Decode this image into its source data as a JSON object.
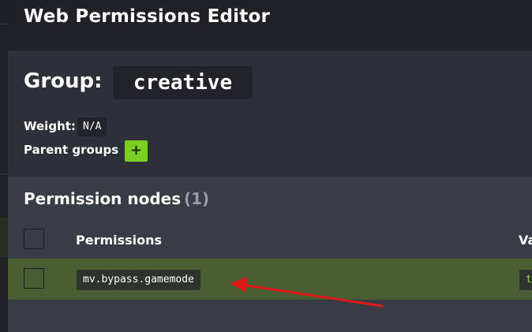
{
  "app": {
    "title": "Web Permissions Editor"
  },
  "group": {
    "label": "Group:",
    "name": "creative",
    "weight_label": "Weight:",
    "weight_value": "N/A",
    "parent_groups_label": "Parent groups",
    "add_parent_symbol": "+"
  },
  "permission_nodes": {
    "header": "Permission nodes",
    "count": "(1)",
    "columns": {
      "permissions": "Permissions",
      "value": "Va"
    },
    "rows": [
      {
        "permission": "mv.bypass.gamemode",
        "value": "t"
      }
    ]
  },
  "colors": {
    "accent_green": "#7ad020",
    "selected_row": "#4b5e33",
    "annotation_arrow": "#e01818"
  }
}
